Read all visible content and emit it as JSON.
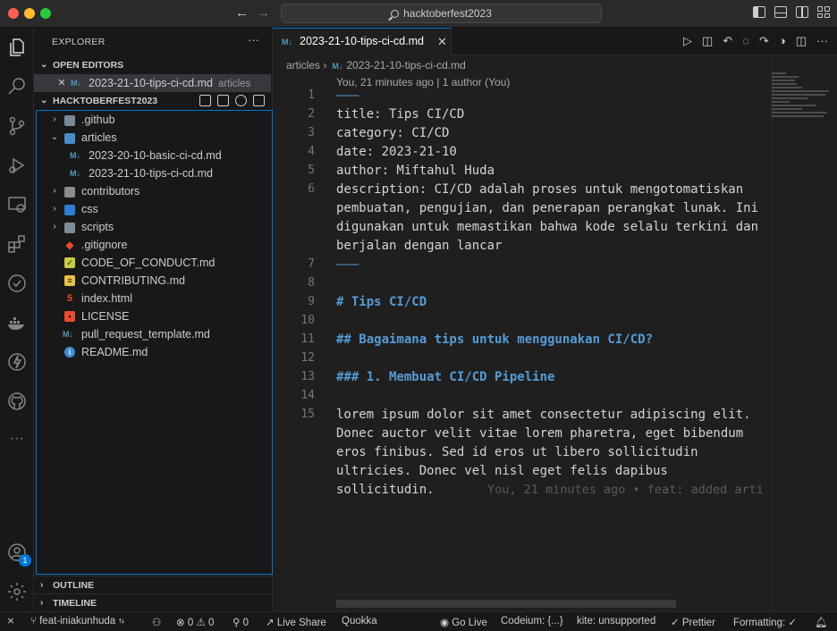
{
  "titlebar": {
    "search_text": "hacktoberfest2023"
  },
  "sidebar": {
    "title": "EXPLORER",
    "more": "···",
    "open_editors_header": "OPEN EDITORS",
    "open_editor": {
      "close": "✕",
      "icon": "M↓",
      "filename": "2023-21-10-tips-ci-cd.md",
      "folder": "articles"
    },
    "project_header": "HACKTOBERFEST2023",
    "tree": [
      {
        "label": ".github",
        "type": "folder",
        "icon": "github-folder-icon"
      },
      {
        "label": "articles",
        "type": "folder-open",
        "icon": "articles-folder-icon"
      },
      {
        "label": "2023-20-10-basic-ci-cd.md",
        "type": "md",
        "icon": "markdown-icon"
      },
      {
        "label": "2023-21-10-tips-ci-cd.md",
        "type": "md",
        "icon": "markdown-icon"
      },
      {
        "label": "contributors",
        "type": "folder",
        "icon": "folder-icon"
      },
      {
        "label": "css",
        "type": "folder",
        "icon": "css-folder-icon"
      },
      {
        "label": "scripts",
        "type": "folder",
        "icon": "scripts-folder-icon"
      },
      {
        "label": ".gitignore",
        "type": "file",
        "icon": "git-icon"
      },
      {
        "label": "CODE_OF_CONDUCT.md",
        "type": "file",
        "icon": "conduct-icon"
      },
      {
        "label": "CONTRIBUTING.md",
        "type": "file",
        "icon": "contributing-icon"
      },
      {
        "label": "index.html",
        "type": "file",
        "icon": "html-icon"
      },
      {
        "label": "LICENSE",
        "type": "file",
        "icon": "license-icon"
      },
      {
        "label": "pull_request_template.md",
        "type": "file",
        "icon": "markdown-icon"
      },
      {
        "label": "README.md",
        "type": "file",
        "icon": "info-icon"
      }
    ],
    "outline_header": "OUTLINE",
    "timeline_header": "TIMELINE"
  },
  "editor": {
    "tab": {
      "icon": "M↓",
      "filename": "2023-21-10-tips-ci-cd.md",
      "close": "✕"
    },
    "breadcrumb": {
      "folder": "articles",
      "sep": "›",
      "icon": "M↓",
      "file": "2023-21-10-tips-ci-cd.md"
    },
    "blame_header": "You, 21 minutes ago | 1 author (You)",
    "lines": [
      {
        "n": "1",
        "text": "———"
      },
      {
        "n": "2",
        "text": "title: Tips CI/CD"
      },
      {
        "n": "3",
        "text": "category: CI/CD"
      },
      {
        "n": "4",
        "text": "date: 2023-21-10"
      },
      {
        "n": "5",
        "text": "author: Miftahul Huda"
      },
      {
        "n": "6",
        "text": "description: CI/CD adalah proses untuk mengotomatiskan"
      },
      {
        "n": "",
        "text": "pembuatan, pengujian, dan penerapan perangkat lunak. Ini"
      },
      {
        "n": "",
        "text": "digunakan untuk memastikan bahwa kode selalu terkini dan"
      },
      {
        "n": "",
        "text": "berjalan dengan lancar"
      },
      {
        "n": "7",
        "text": "———"
      },
      {
        "n": "8",
        "text": ""
      },
      {
        "n": "9",
        "text": "# Tips CI/CD"
      },
      {
        "n": "10",
        "text": ""
      },
      {
        "n": "11",
        "text": "## Bagaimana tips untuk menggunakan CI/CD?"
      },
      {
        "n": "12",
        "text": ""
      },
      {
        "n": "13",
        "text": "### 1. Membuat CI/CD Pipeline"
      },
      {
        "n": "14",
        "text": ""
      },
      {
        "n": "15",
        "text": "lorem ipsum dolor sit amet consectetur adipiscing elit."
      },
      {
        "n": "",
        "text": "Donec auctor velit vitae lorem pharetra, eget bibendum"
      },
      {
        "n": "",
        "text": "eros finibus. Sed id eros ut libero sollicitudin"
      },
      {
        "n": "",
        "text": "ultricies. Donec vel nisl eget felis dapibus"
      },
      {
        "n": "",
        "text": "sollicitudin."
      }
    ],
    "inline_blame": "You, 21 minutes ago • feat: added arti"
  },
  "statusbar": {
    "remote": "⨯",
    "branch": "feat-iniakunhuda",
    "errors": "⊗ 0",
    "warnings": "⚠ 0",
    "ports": "0",
    "live_share": "Live Share",
    "quokka": "Quokka",
    "go_live": "Go Live",
    "codeium": "Codeium: {...}",
    "kite": "kite: unsupported",
    "prettier": "Prettier",
    "formatting": "Formatting: ✓"
  },
  "activity_badge": "1",
  "colors": {
    "accent": "#0078d4",
    "markdown_icon": "#519aba",
    "heading": "#569cd6"
  }
}
